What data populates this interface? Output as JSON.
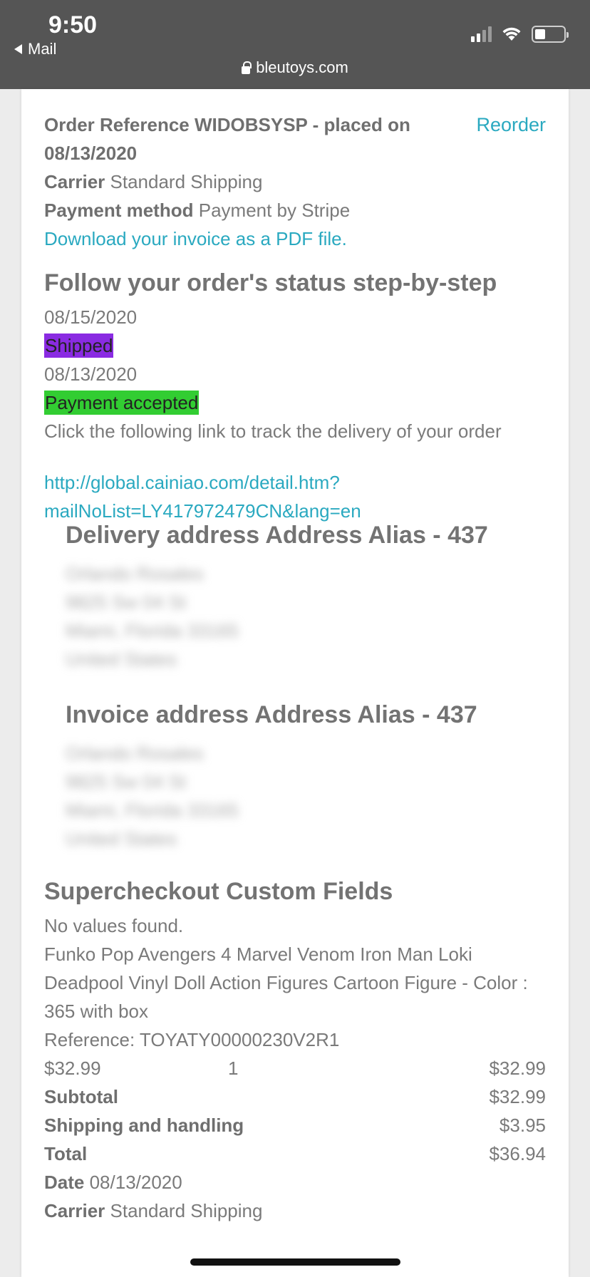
{
  "status_bar": {
    "time": "9:50",
    "back_label": "Mail",
    "url": "bleutoys.com"
  },
  "order": {
    "reference_text": "Order Reference WIDOBSYSP - placed on 08/13/2020",
    "reorder_label": "Reorder",
    "carrier_label": "Carrier",
    "carrier_value": "Standard Shipping",
    "payment_label": "Payment method",
    "payment_value": "Payment by Stripe",
    "invoice_link": "Download your invoice as a PDF file."
  },
  "status_section": {
    "title": "Follow your order's status step-by-step",
    "history": [
      {
        "date": "08/15/2020",
        "status": "Shipped",
        "color": "#8a2be2"
      },
      {
        "date": "08/13/2020",
        "status": "Payment accepted",
        "color": "#32cd32"
      }
    ],
    "tracking_text": "Click the following link to track the delivery of your order",
    "tracking_link_line1": "http://global.cainiao.com/detail.htm?",
    "tracking_link_line2": "mailNoList=LY417972479CN&lang=en"
  },
  "delivery_address": {
    "title": "Delivery address Address Alias - 437",
    "lines": [
      "Orlando Rosales",
      "9825 Sw 04 St",
      "Miami, Florida 33165",
      "United States"
    ]
  },
  "invoice_address": {
    "title": "Invoice address Address Alias - 437",
    "lines": [
      "Orlando Rosales",
      "9825 Sw 04 St",
      "Miami, Florida 33165",
      "United States"
    ]
  },
  "custom_fields": {
    "title": "Supercheckout Custom Fields",
    "no_values": "No values found."
  },
  "product": {
    "name": "Funko Pop Avengers 4 Marvel Venom Iron Man Loki Deadpool Vinyl Doll Action Figures Cartoon Figure - Color : 365 with box",
    "reference": "Reference: TOYATY00000230V2R1",
    "unit_price": "$32.99",
    "quantity": "1",
    "line_total": "$32.99"
  },
  "totals": {
    "subtotal_label": "Subtotal",
    "subtotal_value": "$32.99",
    "shipping_label": "Shipping and handling",
    "shipping_value": "$3.95",
    "total_label": "Total",
    "total_value": "$36.94",
    "date_label": "Date",
    "date_value": "08/13/2020",
    "carrier_label": "Carrier",
    "carrier_value": "Standard Shipping"
  },
  "colors": {
    "link": "#2aa9c0",
    "topbar": "#555555",
    "shipped": "#8a2be2",
    "payment_accepted": "#32cd32"
  }
}
